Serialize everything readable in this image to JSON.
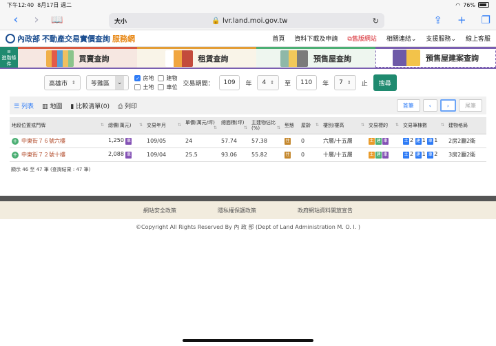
{
  "status": {
    "time": "下午12:40",
    "date": "8月17日 週二",
    "battery": "76%"
  },
  "browser": {
    "aa": "大小",
    "url": "lvr.land.moi.gov.tw"
  },
  "header": {
    "moi": "內政部",
    "title1": "不動產交易實價查詢",
    "title2": "服務網"
  },
  "topnav": [
    "首頁",
    "資料下載及申請",
    "舊版網站",
    "相關連結",
    "支援服務",
    "線上客服"
  ],
  "side_condition": "進階條件",
  "tabs": [
    "買賣查詢",
    "租賃查詢",
    "預售屋查詢",
    "預售屋建案查詢"
  ],
  "filter": {
    "city": "高雄市",
    "district": "苓雅區",
    "checks": [
      {
        "label": "房地",
        "checked": true
      },
      {
        "label": "建物",
        "checked": false
      },
      {
        "label": "土地",
        "checked": false
      },
      {
        "label": "車位",
        "checked": false
      }
    ],
    "period_label": "交易期間：",
    "from_year": "109",
    "year_unit": "年",
    "from_month": "4",
    "to_label": "至",
    "to_year": "110",
    "to_month": "7",
    "end_label": "止",
    "search_label": "搜尋"
  },
  "viewbar": {
    "list": "列表",
    "map": "地圖",
    "compare": "比較清單(0)",
    "print": "列印",
    "first": "首筆",
    "prev": "‹",
    "next": "›",
    "last": "尾筆"
  },
  "table": {
    "headers": [
      "地段位置或門牌",
      "總價(萬元)",
      "交易年月",
      "單價(萬元/坪)",
      "總面積(坪)",
      "主建物佔比(%)",
      "型態",
      "屋齡",
      "樓別/樓高",
      "交易標的",
      "交易筆棟數",
      "建物格局"
    ],
    "rows": [
      {
        "addr": "中東街７６號六樓",
        "total": "1,250",
        "total_tag": "車",
        "date": "109/05",
        "unit": "24",
        "area": "57.74",
        "ratio": "57.38",
        "type": "住",
        "age": "0",
        "floor": "六層/十五層",
        "tags": [
          "土",
          "建",
          "車"
        ],
        "counts": [
          "2",
          "1",
          "1"
        ],
        "layout": "2房2廳2衛"
      },
      {
        "addr": "中東街７２號十樓",
        "total": "2,088",
        "total_tag": "車",
        "date": "109/04",
        "unit": "25.5",
        "area": "93.06",
        "ratio": "55.82",
        "type": "住",
        "age": "0",
        "floor": "十層/十五層",
        "tags": [
          "土",
          "建",
          "車"
        ],
        "counts": [
          "2",
          "1",
          "2"
        ],
        "layout": "3房2廳2衛"
      }
    ]
  },
  "result_line": "顯示 46 至 47 筆 (查詢結果 : 47 筆)",
  "footer": {
    "links": [
      "網站安全政策",
      "隱私權保護政策",
      "政府網站資料開放宣告"
    ],
    "copyright": "©Copyright All Rights Reserved By 內 政 部 (Dept of Land Administration M. O. I. )"
  }
}
